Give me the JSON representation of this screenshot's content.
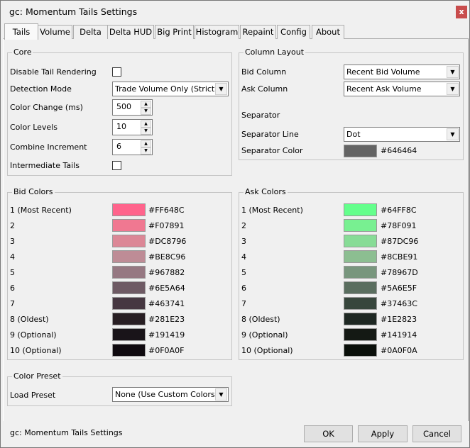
{
  "window": {
    "title": "gc: Momentum Tails Settings",
    "close_label": "x"
  },
  "tabs": [
    {
      "label": "Tails",
      "selected": true
    },
    {
      "label": "Volume"
    },
    {
      "label": "Delta"
    },
    {
      "label": "Delta HUD"
    },
    {
      "label": "Big Print"
    },
    {
      "label": "Histogram"
    },
    {
      "label": "Repaint"
    },
    {
      "label": "Config"
    },
    {
      "label": "About"
    }
  ],
  "core": {
    "title": "Core",
    "disable_tail_rendering": {
      "label": "Disable Tail Rendering",
      "checked": false
    },
    "detection_mode": {
      "label": "Detection Mode",
      "value": "Trade Volume Only (Strict)"
    },
    "color_change": {
      "label": "Color Change (ms)",
      "value": "500"
    },
    "color_levels": {
      "label": "Color Levels",
      "value": "10"
    },
    "combine_increment": {
      "label": "Combine Increment",
      "value": "6"
    },
    "intermediate_tails": {
      "label": "Intermediate Tails",
      "checked": false
    }
  },
  "column_layout": {
    "title": "Column Layout",
    "bid_column": {
      "label": "Bid Column",
      "value": "Recent Bid Volume"
    },
    "ask_column": {
      "label": "Ask Column",
      "value": "Recent Ask Volume"
    },
    "separator_heading": "Separator",
    "separator_line": {
      "label": "Separator Line",
      "value": "Dot"
    },
    "separator_color": {
      "label": "Separator Color",
      "value": "#646464"
    }
  },
  "bid_colors": {
    "title": "Bid Colors",
    "items": [
      {
        "label": "1 (Most Recent)",
        "value": "#FF648C"
      },
      {
        "label": "2",
        "value": "#F07891"
      },
      {
        "label": "3",
        "value": "#DC8796"
      },
      {
        "label": "4",
        "value": "#BE8C96"
      },
      {
        "label": "5",
        "value": "#967882"
      },
      {
        "label": "6",
        "value": "#6E5A64"
      },
      {
        "label": "7",
        "value": "#463741"
      },
      {
        "label": "8 (Oldest)",
        "value": "#281E23"
      },
      {
        "label": "9 (Optional)",
        "value": "#191419"
      },
      {
        "label": "10 (Optional)",
        "value": "#0F0A0F"
      }
    ]
  },
  "ask_colors": {
    "title": "Ask Colors",
    "items": [
      {
        "label": "1 (Most Recent)",
        "value": "#64FF8C"
      },
      {
        "label": "2",
        "value": "#78F091"
      },
      {
        "label": "3",
        "value": "#87DC96"
      },
      {
        "label": "4",
        "value": "#8CBE91"
      },
      {
        "label": "5",
        "value": "#78967D"
      },
      {
        "label": "6",
        "value": "#5A6E5F"
      },
      {
        "label": "7",
        "value": "#37463C"
      },
      {
        "label": "8 (Oldest)",
        "value": "#1E2823"
      },
      {
        "label": "9 (Optional)",
        "value": "#141914"
      },
      {
        "label": "10 (Optional)",
        "value": "#0A0F0A"
      }
    ]
  },
  "color_preset": {
    "title": "Color Preset",
    "load_preset": {
      "label": "Load Preset",
      "value": "None (Use Custom Colors)"
    }
  },
  "footer": {
    "status": "gc: Momentum Tails Settings",
    "ok": "OK",
    "apply": "Apply",
    "cancel": "Cancel"
  }
}
